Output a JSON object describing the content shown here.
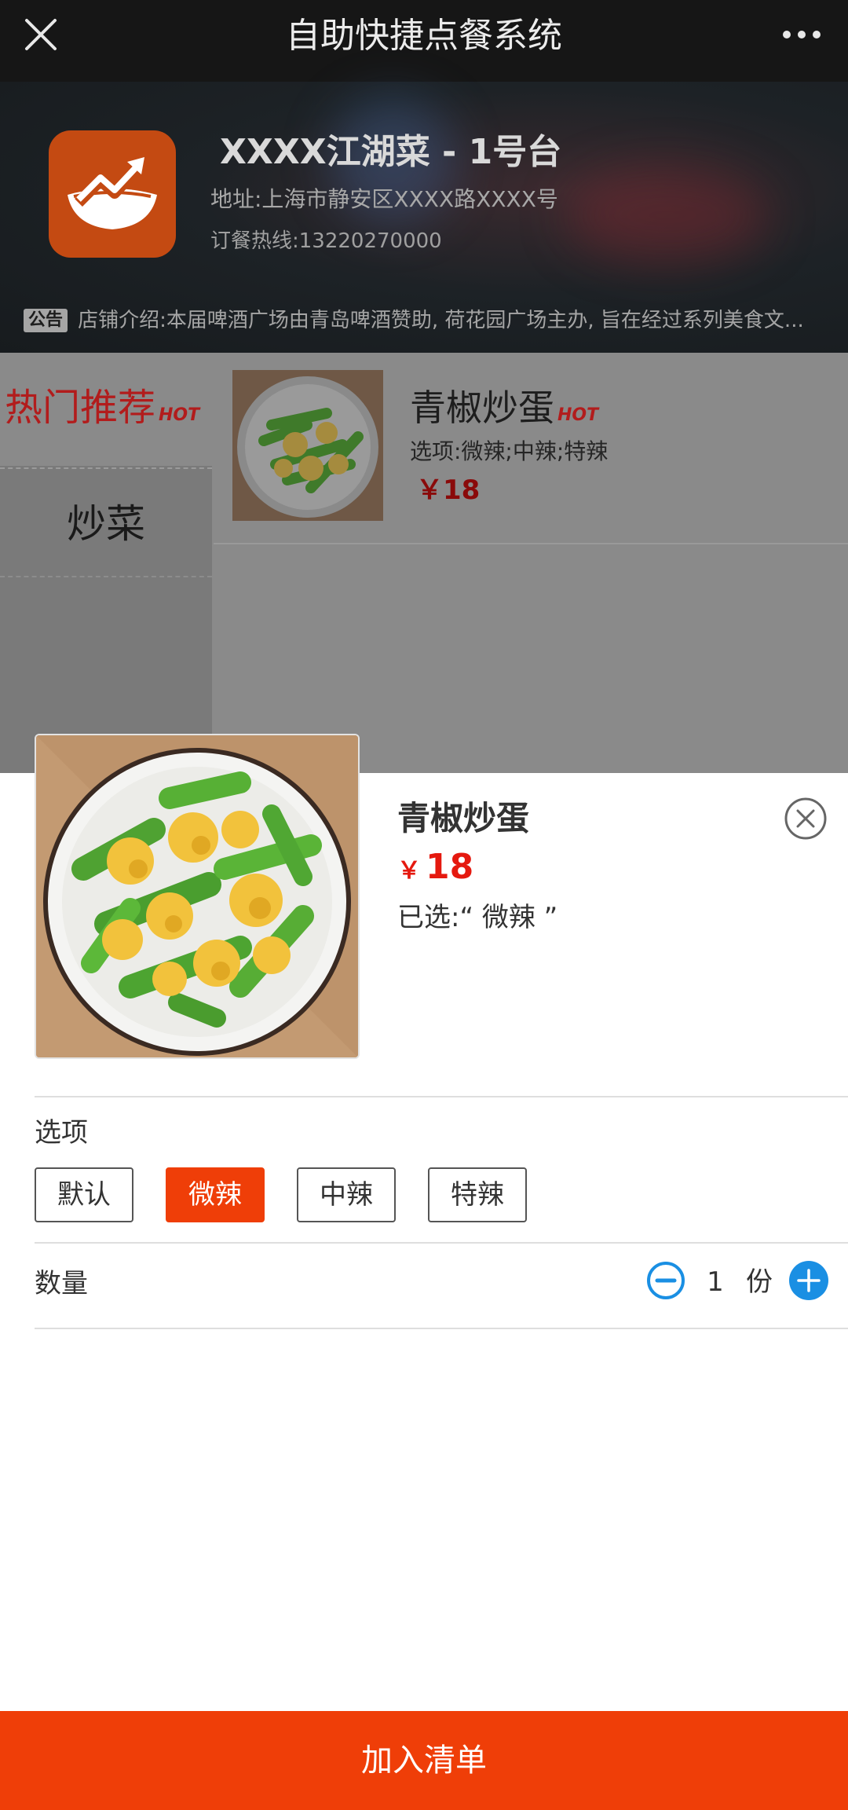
{
  "navbar": {
    "title": "自助快捷点餐系统",
    "close_icon": "close-icon",
    "more_icon": "more-dots-icon"
  },
  "shop": {
    "name": "XXXX江湖菜 - 1号台",
    "address": "地址:上海市静安区XXXX路XXXX号",
    "phone": "订餐热线:13220270000",
    "notice_badge": "公告",
    "notice_text": "店铺介绍:本届啤酒广场由青岛啤酒赞助, 荷花园广场主办, 旨在经过系列美食文...",
    "brand_color": "#c44a12"
  },
  "categories": [
    {
      "label": "热门推荐",
      "tag": "HOT",
      "active": true
    },
    {
      "label": "炒菜",
      "active": false
    }
  ],
  "menu_item": {
    "name": "青椒炒蛋",
    "tag": "HOT",
    "options": "选项:微辣;中辣;特辣",
    "price": "￥18"
  },
  "sheet": {
    "name": "青椒炒蛋",
    "price_symbol": "￥",
    "price_value": "18",
    "selected_text": "已选:“ 微辣 ”",
    "options_label": "选项",
    "options": [
      "默认",
      "微辣",
      "中辣",
      "特辣"
    ],
    "selected_option": "微辣",
    "quantity_label": "数量",
    "quantity": "1",
    "unit": "份",
    "add_button": "加入清单"
  },
  "colors": {
    "accent": "#ef3e08",
    "price_red": "#e5190f",
    "stepper_blue": "#1a8fe3",
    "hot_red": "#b21c1c"
  }
}
